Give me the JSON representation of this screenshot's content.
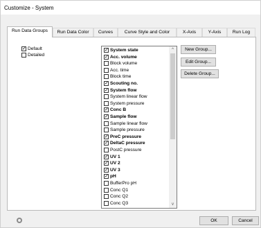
{
  "window": {
    "title": "Customize - System"
  },
  "tabs": [
    {
      "label": "Run Data Groups"
    },
    {
      "label": "Run Data Color"
    },
    {
      "label": "Curves"
    },
    {
      "label": "Curve Style and Color"
    },
    {
      "label": "X-Axis"
    },
    {
      "label": "Y-Axis"
    },
    {
      "label": "Run Log"
    }
  ],
  "groups": [
    {
      "label": "Default",
      "checked": true
    },
    {
      "label": "Detailed",
      "checked": false
    }
  ],
  "items": [
    {
      "label": "System state",
      "checked": true,
      "bold": true
    },
    {
      "label": "Acc. volume",
      "checked": true,
      "bold": true
    },
    {
      "label": "Block volume",
      "checked": false,
      "bold": false
    },
    {
      "label": "Acc. time",
      "checked": false,
      "bold": false
    },
    {
      "label": "Block time",
      "checked": false,
      "bold": false
    },
    {
      "label": "Scouting no.",
      "checked": true,
      "bold": true
    },
    {
      "label": "System flow",
      "checked": true,
      "bold": true
    },
    {
      "label": "System linear flow",
      "checked": false,
      "bold": false
    },
    {
      "label": "System pressure",
      "checked": false,
      "bold": false
    },
    {
      "label": "Conc B",
      "checked": true,
      "bold": true
    },
    {
      "label": "Sample flow",
      "checked": true,
      "bold": true
    },
    {
      "label": "Sample linear flow",
      "checked": false,
      "bold": false
    },
    {
      "label": "Sample pressure",
      "checked": false,
      "bold": false
    },
    {
      "label": "PreC pressure",
      "checked": true,
      "bold": true
    },
    {
      "label": "DeltaC pressure",
      "checked": true,
      "bold": true
    },
    {
      "label": "PostC pressure",
      "checked": false,
      "bold": false
    },
    {
      "label": "UV 1",
      "checked": true,
      "bold": true
    },
    {
      "label": "UV 2",
      "checked": true,
      "bold": true
    },
    {
      "label": "UV 3",
      "checked": true,
      "bold": true
    },
    {
      "label": "pH",
      "checked": true,
      "bold": true
    },
    {
      "label": "BufferPro pH",
      "checked": false,
      "bold": false
    },
    {
      "label": "Conc Q1",
      "checked": false,
      "bold": false
    },
    {
      "label": "Conc Q2",
      "checked": false,
      "bold": false
    },
    {
      "label": "Conc Q3",
      "checked": false,
      "bold": false
    }
  ],
  "group_buttons": {
    "new": "New Group...",
    "edit": "Edit Group...",
    "delete": "Delete Group..."
  },
  "footer": {
    "ok": "OK",
    "cancel": "Cancel",
    "icon": "settings-icon"
  },
  "scroll_icons": {
    "up": "^",
    "down": "v"
  }
}
